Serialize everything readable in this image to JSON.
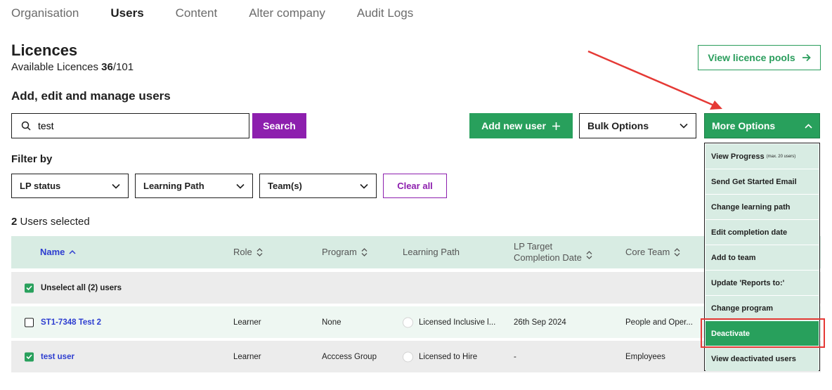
{
  "nav": {
    "tabs": [
      {
        "label": "Organisation"
      },
      {
        "label": "Users"
      },
      {
        "label": "Content"
      },
      {
        "label": "Alter company"
      },
      {
        "label": "Audit Logs"
      }
    ]
  },
  "licences": {
    "title": "Licences",
    "available_label": "Available Licences",
    "available": "36",
    "total": "/101",
    "view_pools_label": "View licence pools"
  },
  "manage": {
    "title": "Add, edit and manage users",
    "search_value": "test",
    "search_button": "Search",
    "add_user_label": "Add new user",
    "bulk_label": "Bulk Options",
    "more_label": "More Options"
  },
  "filter": {
    "title": "Filter by",
    "lp_status": "LP status",
    "learning_path": "Learning Path",
    "teams": "Team(s)",
    "clear_all": "Clear all"
  },
  "selection": {
    "count": "2",
    "suffix": "Users selected"
  },
  "table": {
    "headers": {
      "name": "Name",
      "role": "Role",
      "program": "Program",
      "learning_path": "Learning Path",
      "lp_target_1": "LP Target",
      "lp_target_2": "Completion Date",
      "core_team": "Core Team"
    },
    "unselect_all": "Unselect all (2) users",
    "rows": [
      {
        "name": "ST1-7348 Test 2",
        "role": "Learner",
        "program": "None",
        "learning_path": "Licensed Inclusive l...",
        "target_date": "26th Sep 2024",
        "core_team": "People and Oper..."
      },
      {
        "name": "test user",
        "role": "Learner",
        "program": "Acccess Group",
        "learning_path": "Licensed to Hire",
        "target_date": "-",
        "core_team": "Employees"
      }
    ]
  },
  "more_menu": {
    "items": [
      {
        "label": "View Progress",
        "note": "(max. 20 users)"
      },
      {
        "label": "Send Get Started Email"
      },
      {
        "label": "Change learning path"
      },
      {
        "label": "Edit completion date"
      },
      {
        "label": "Add to team"
      },
      {
        "label": "Update 'Reports to:'"
      },
      {
        "label": "Change program"
      },
      {
        "label": "Deactivate"
      },
      {
        "label": "View deactivated users"
      }
    ]
  },
  "colors": {
    "green": "#28a05c",
    "purple": "#8d1fae",
    "header_bg": "#d8ece3",
    "link_blue": "#2d3dd0",
    "annotation_red": "#e53935"
  }
}
